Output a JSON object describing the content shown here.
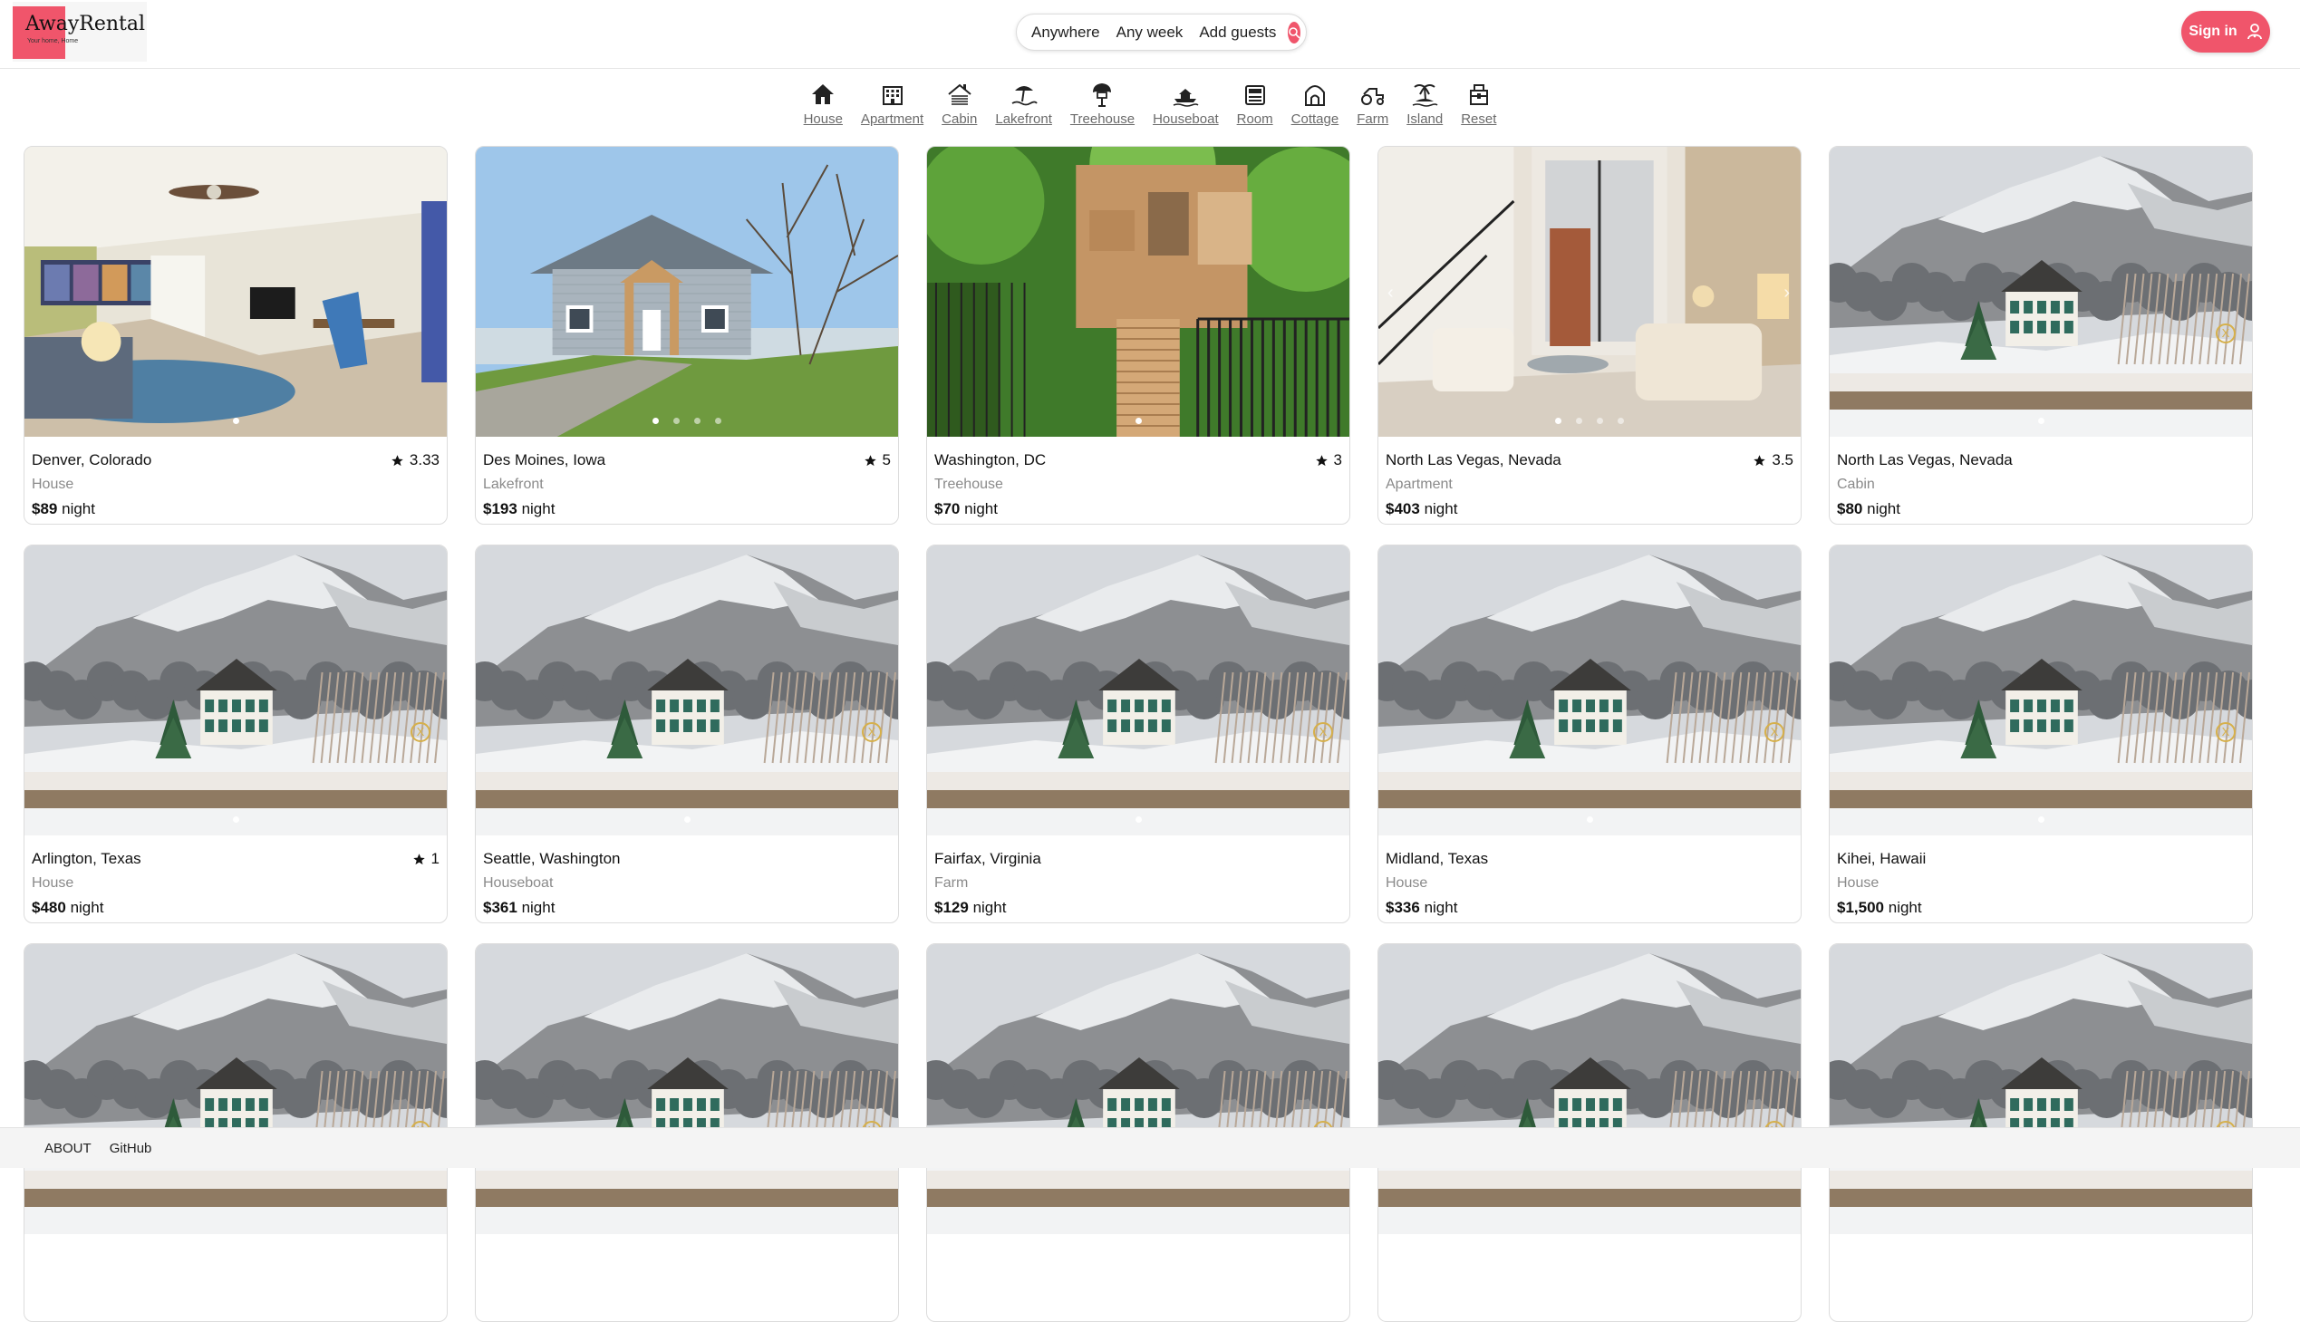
{
  "brand": {
    "name": "AwayRental",
    "tagline": "Your home, Home"
  },
  "search": {
    "where": "Anywhere",
    "when": "Any week",
    "who": "Add guests"
  },
  "auth": {
    "signin_label": "Sign in"
  },
  "categories": [
    {
      "label": "House",
      "icon": "house-icon"
    },
    {
      "label": "Apartment",
      "icon": "apartment-icon"
    },
    {
      "label": "Cabin",
      "icon": "cabin-icon"
    },
    {
      "label": "Lakefront",
      "icon": "lakefront-icon"
    },
    {
      "label": "Treehouse",
      "icon": "treehouse-icon"
    },
    {
      "label": "Houseboat",
      "icon": "houseboat-icon"
    },
    {
      "label": "Room",
      "icon": "room-icon"
    },
    {
      "label": "Cottage",
      "icon": "cottage-icon"
    },
    {
      "label": "Farm",
      "icon": "farm-icon"
    },
    {
      "label": "Island",
      "icon": "island-icon"
    },
    {
      "label": "Reset",
      "icon": "reset-icon"
    }
  ],
  "listings": [
    {
      "location": "Denver, Colorado",
      "type": "House",
      "price": "$89",
      "unit": "night",
      "rating": "3.33",
      "photo": "interior",
      "dots": 1
    },
    {
      "location": "Des Moines, Iowa",
      "type": "Lakefront",
      "price": "$193",
      "unit": "night",
      "rating": "5",
      "photo": "lakehouse",
      "dots": 4
    },
    {
      "location": "Washington, DC",
      "type": "Treehouse",
      "price": "$70",
      "unit": "night",
      "rating": "3",
      "photo": "treehouse",
      "dots": 1
    },
    {
      "location": "North Las Vegas, Nevada",
      "type": "Apartment",
      "price": "$403",
      "unit": "night",
      "rating": "3.5",
      "photo": "lounge",
      "dots": 4
    },
    {
      "location": "North Las Vegas, Nevada",
      "type": "Cabin",
      "price": "$80",
      "unit": "night",
      "rating": "",
      "photo": "snow",
      "dots": 1
    },
    {
      "location": "Arlington, Texas",
      "type": "House",
      "price": "$480",
      "unit": "night",
      "rating": "1",
      "photo": "snow",
      "dots": 1
    },
    {
      "location": "Seattle, Washington",
      "type": "Houseboat",
      "price": "$361",
      "unit": "night",
      "rating": "",
      "photo": "snow",
      "dots": 1
    },
    {
      "location": "Fairfax, Virginia",
      "type": "Farm",
      "price": "$129",
      "unit": "night",
      "rating": "",
      "photo": "snow",
      "dots": 1
    },
    {
      "location": "Midland, Texas",
      "type": "House",
      "price": "$336",
      "unit": "night",
      "rating": "",
      "photo": "snow",
      "dots": 1
    },
    {
      "location": "Kihei, Hawaii",
      "type": "House",
      "price": "$1,500",
      "unit": "night",
      "rating": "",
      "photo": "snow",
      "dots": 1
    },
    {
      "location": "",
      "type": "",
      "price": "",
      "unit": "",
      "rating": "",
      "photo": "snow",
      "dots": 0
    },
    {
      "location": "",
      "type": "",
      "price": "",
      "unit": "",
      "rating": "",
      "photo": "snow",
      "dots": 0
    },
    {
      "location": "",
      "type": "",
      "price": "",
      "unit": "",
      "rating": "",
      "photo": "snow",
      "dots": 0
    },
    {
      "location": "",
      "type": "",
      "price": "",
      "unit": "",
      "rating": "",
      "photo": "snow",
      "dots": 0
    },
    {
      "location": "",
      "type": "",
      "price": "",
      "unit": "",
      "rating": "",
      "photo": "snow",
      "dots": 0
    }
  ],
  "footer": {
    "about": "ABOUT",
    "github": "GitHub"
  },
  "colors": {
    "accent": "#f0556b",
    "muted_text": "#8a8a8a"
  }
}
